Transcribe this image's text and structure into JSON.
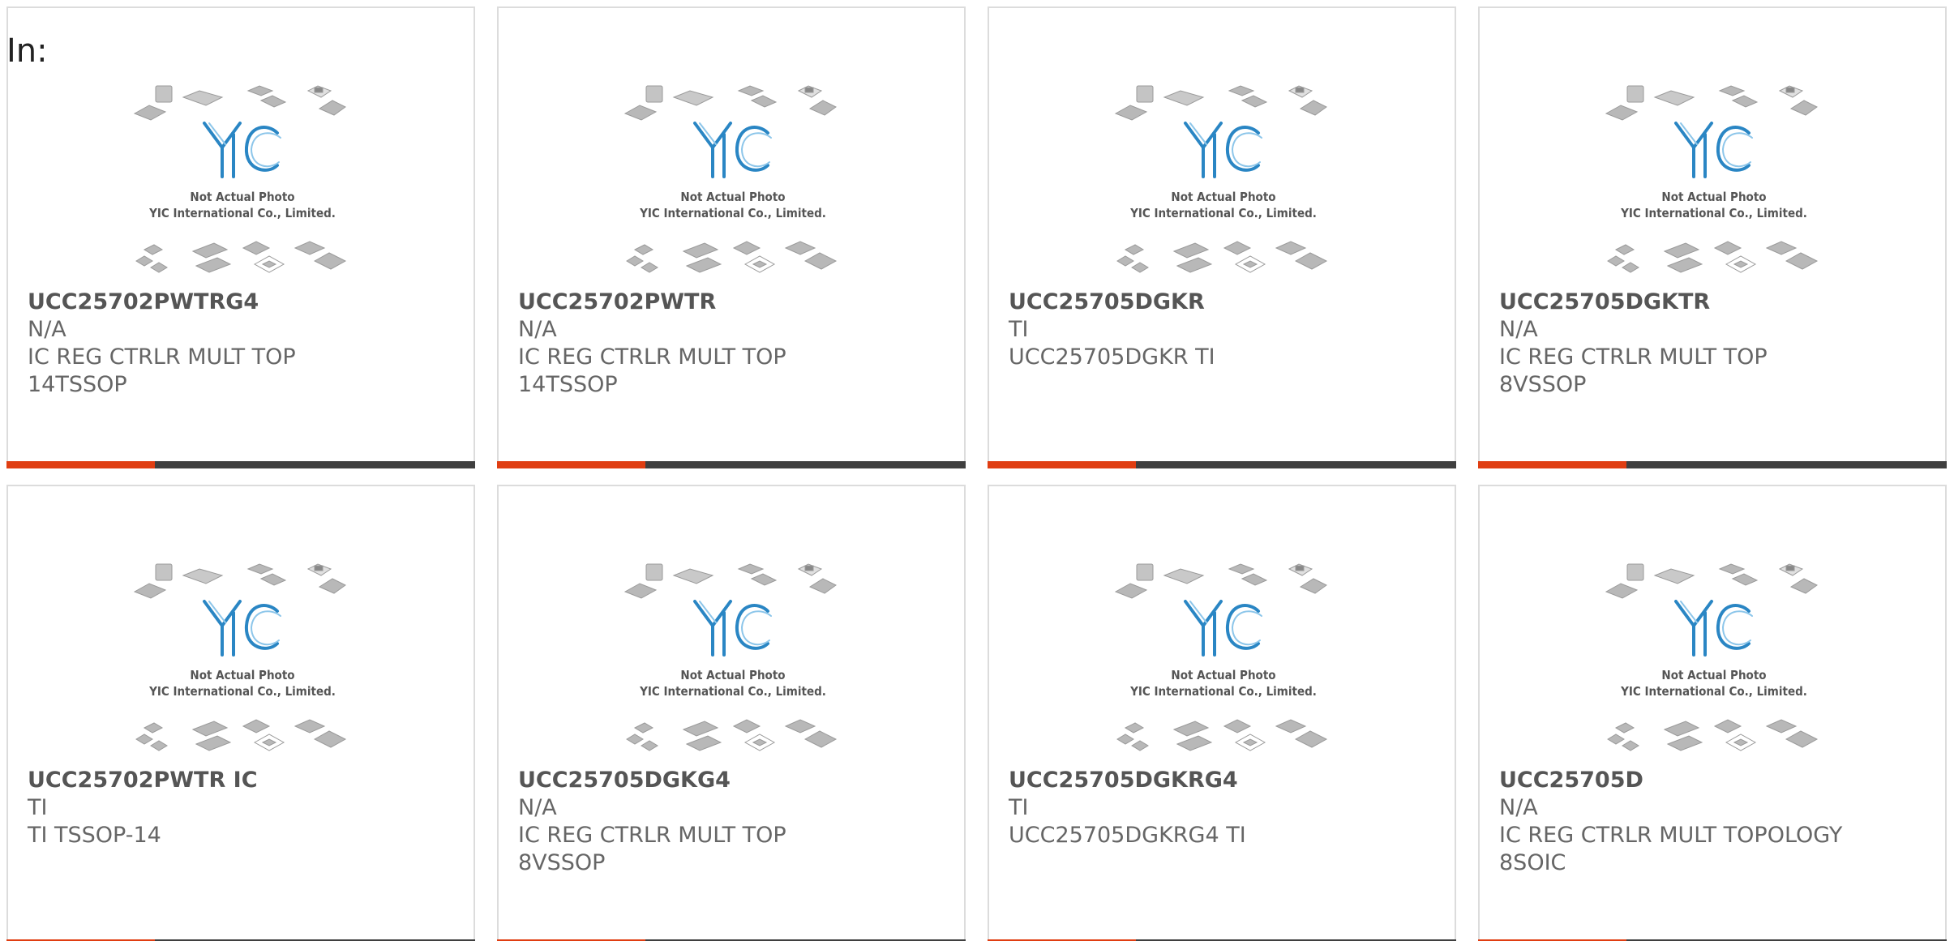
{
  "filter_label": "In:",
  "photo_caption": {
    "line1": "Not Actual Photo",
    "line2": "YIC International Co., Limited."
  },
  "colors": {
    "accent_bar": "#e03e12",
    "bar": "#3f3f3f",
    "logo": "#2a86c4",
    "chips": "#b3b3b3"
  },
  "products": [
    {
      "part_number": "UCC25702PWTRG4",
      "manufacturer": "N/A",
      "desc1": "IC REG CTRLR MULT TOP",
      "desc2": "14TSSOP"
    },
    {
      "part_number": "UCC25702PWTR",
      "manufacturer": "N/A",
      "desc1": "IC REG CTRLR MULT TOP",
      "desc2": "14TSSOP"
    },
    {
      "part_number": "UCC25705DGKR",
      "manufacturer": "TI",
      "desc1": "UCC25705DGKR TI",
      "desc2": ""
    },
    {
      "part_number": "UCC25705DGKTR",
      "manufacturer": "N/A",
      "desc1": "IC REG CTRLR MULT TOP",
      "desc2": "8VSSOP"
    },
    {
      "part_number": "UCC25702PWTR IC",
      "manufacturer": "TI",
      "desc1": "TI TSSOP-14",
      "desc2": ""
    },
    {
      "part_number": "UCC25705DGKG4",
      "manufacturer": "N/A",
      "desc1": "IC REG CTRLR MULT TOP",
      "desc2": "8VSSOP"
    },
    {
      "part_number": "UCC25705DGKRG4",
      "manufacturer": "TI",
      "desc1": "UCC25705DGKRG4 TI",
      "desc2": ""
    },
    {
      "part_number": "UCC25705D",
      "manufacturer": "N/A",
      "desc1": "IC REG CTRLR MULT TOPOLOGY",
      "desc2": "8SOIC"
    }
  ]
}
